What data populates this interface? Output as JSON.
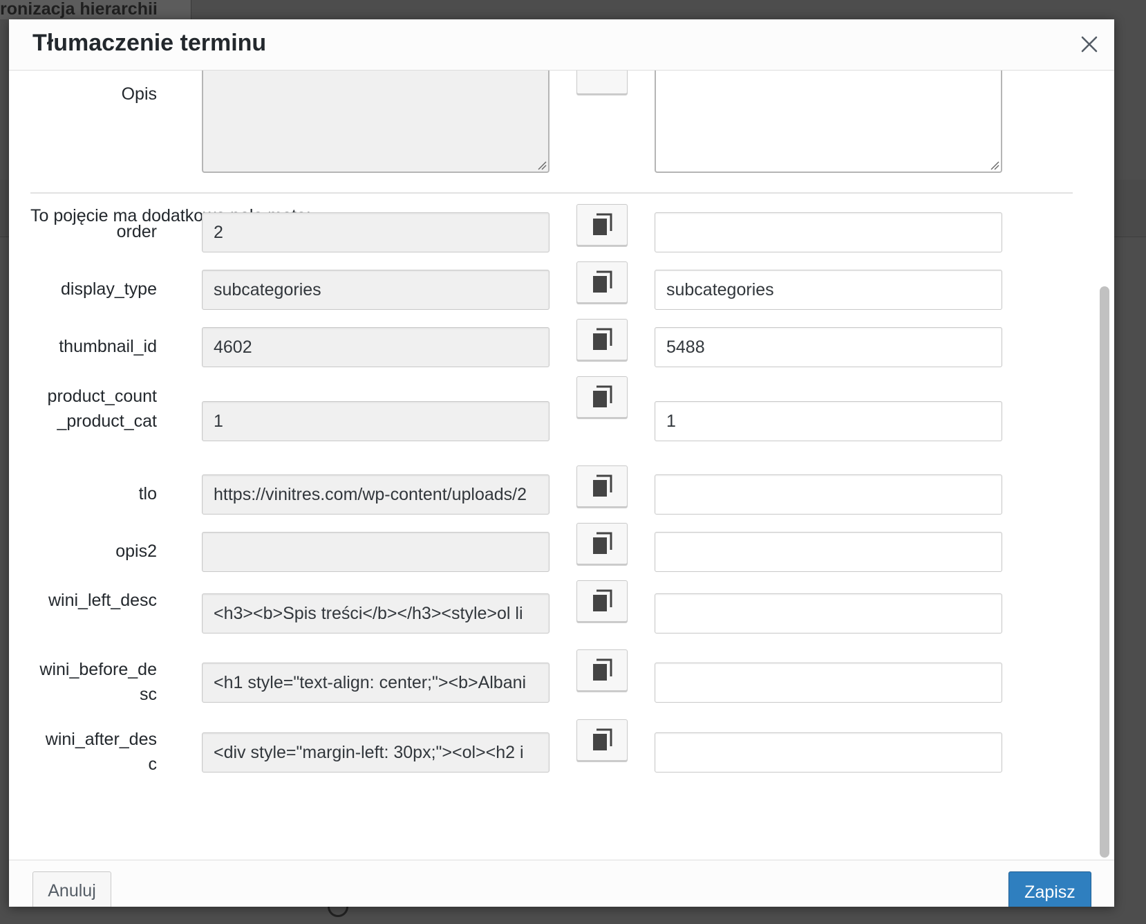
{
  "background": {
    "title_fragment": "ronizacja hierarchii"
  },
  "modal": {
    "title": "Tłumaczenie terminu",
    "close_icon": "close-icon",
    "description": {
      "label": "Opis",
      "source_value": "",
      "target_value": ""
    },
    "meta_intro": "To pojęcie ma dodatkowe pola meta:",
    "meta_fields": [
      {
        "label": "order",
        "source": "2",
        "target": ""
      },
      {
        "label": "display_type",
        "source": "subcategories",
        "target": "subcategories"
      },
      {
        "label": "thumbnail_id",
        "source": "4602",
        "target": "5488"
      },
      {
        "label": "product_count_product_cat",
        "source": "1",
        "target": "1"
      },
      {
        "label": "tlo",
        "source": "https://vinitres.com/wp-content/uploads/2",
        "target": ""
      },
      {
        "label": "opis2",
        "source": "",
        "target": ""
      },
      {
        "label": "wini_left_desc",
        "source": "<h3><b>Spis treści</b></h3><style>ol li",
        "target": ""
      },
      {
        "label": "wini_before_desc",
        "source": "<h1 style=\"text-align: center;\"><b>Albani",
        "target": ""
      },
      {
        "label": "wini_after_desc",
        "source": "<div style=\"margin-left: 30px;\"><ol><h2 i",
        "target": ""
      }
    ],
    "copy_icon": "copy-icon",
    "footer": {
      "cancel_label": "Anuluj",
      "save_label": "Zapisz"
    }
  },
  "colors": {
    "primary": "#2f7fbf",
    "readonly_bg": "#f0f0f0",
    "overlay": "#4d4d4d"
  }
}
